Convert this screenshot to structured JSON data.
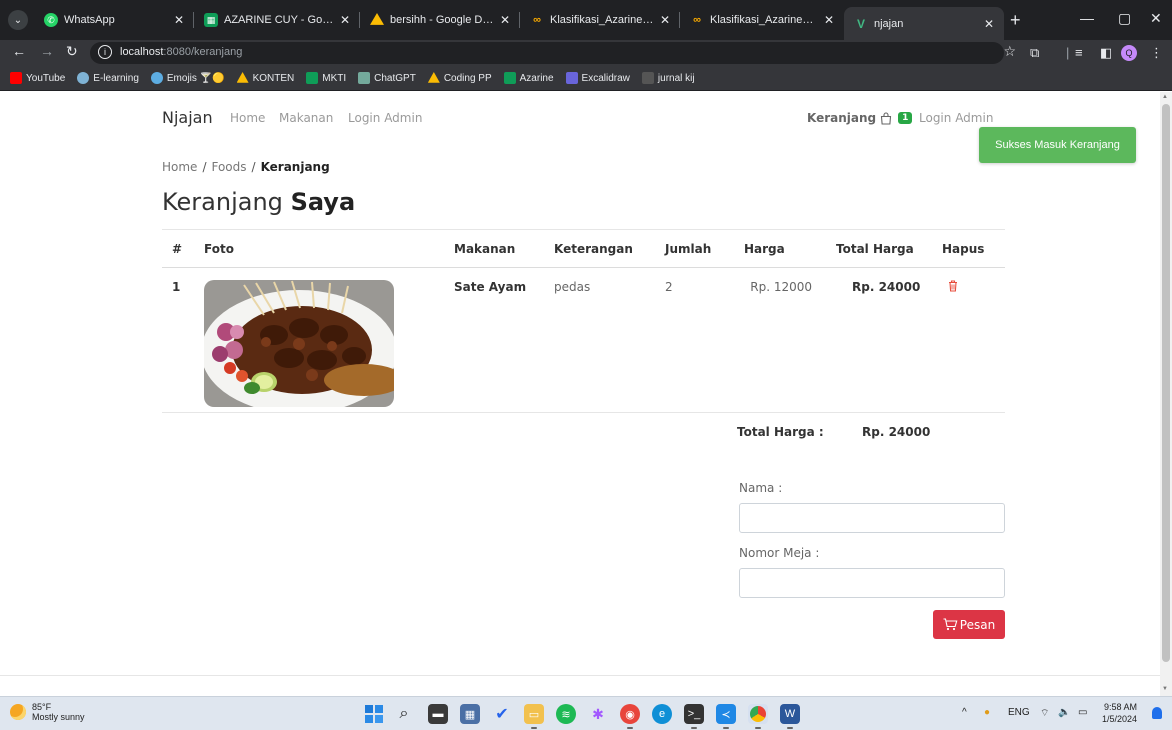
{
  "browser": {
    "tabs": [
      {
        "label": "WhatsApp",
        "icon": "whatsapp-icon",
        "color": "#25d366"
      },
      {
        "label": "AZARINE CUY - Google Sh",
        "icon": "google-sheets-icon",
        "color": "#0f9d58"
      },
      {
        "label": "bersihh - Google Drive",
        "icon": "google-drive-icon",
        "color": "#fbbc04"
      },
      {
        "label": "Klasifikasi_Azarine.ipynb -",
        "icon": "colab-icon",
        "color": "#f9ab00"
      },
      {
        "label": "Klasifikasi_Azarine_PK.ipyn",
        "icon": "colab-icon",
        "color": "#f9ab00"
      },
      {
        "label": "njajan",
        "icon": "vue-icon",
        "color": "#41b883"
      }
    ],
    "url_host": "localhost",
    "url_path": ":8080/keranjang",
    "bookmarks": [
      {
        "label": "YouTube",
        "icon": "youtube-icon",
        "color": "#ff0000"
      },
      {
        "label": "E-learning",
        "icon": "elearning-icon",
        "color": "#7fb3d5"
      },
      {
        "label": "Emojis 🍸🟡",
        "icon": "emoji-icon",
        "color": "#5dade2"
      },
      {
        "label": "KONTEN",
        "icon": "google-drive-icon",
        "color": "#fbbc04"
      },
      {
        "label": "MKTI",
        "icon": "google-sheets-icon",
        "color": "#0f9d58"
      },
      {
        "label": "ChatGPT",
        "icon": "chatgpt-icon",
        "color": "#74aa9c"
      },
      {
        "label": "Coding PP",
        "icon": "google-drive-icon",
        "color": "#fbbc04"
      },
      {
        "label": "Azarine",
        "icon": "google-sheets-icon",
        "color": "#0f9d58"
      },
      {
        "label": "Excalidraw",
        "icon": "excalidraw-icon",
        "color": "#6965db"
      },
      {
        "label": "jurnal kij",
        "icon": "pdf-icon",
        "color": "#555555"
      }
    ],
    "profile_initial": "Q"
  },
  "navbar": {
    "brand": "Njajan",
    "links": [
      "Home",
      "Makanan",
      "Login Admin"
    ],
    "cart_label": "Keranjang",
    "cart_count": "1",
    "right_link": "Login Admin"
  },
  "toast": "Sukses Masuk Keranjang",
  "breadcrumb": {
    "home": "Home",
    "foods": "Foods",
    "current": "Keranjang"
  },
  "heading": {
    "light": "Keranjang",
    "bold": "Saya"
  },
  "table": {
    "headers": [
      "#",
      "Foto",
      "Makanan",
      "Keterangan",
      "Jumlah",
      "Harga",
      "Total Harga",
      "Hapus"
    ],
    "rows": [
      {
        "no": "1",
        "makanan": "Sate Ayam",
        "keterangan": "pedas",
        "jumlah": "2",
        "harga": "Rp. 12000",
        "total": "Rp. 24000"
      }
    ]
  },
  "summary": {
    "label": "Total Harga :",
    "value": "Rp. 24000"
  },
  "form": {
    "nama_label": "Nama :",
    "nama_value": "",
    "meja_label": "Nomor Meja :",
    "meja_value": "",
    "submit": "Pesan"
  },
  "taskbar": {
    "temp": "85°F",
    "weather": "Mostly sunny",
    "lang": "ENG",
    "time": "9:58 AM",
    "date": "1/5/2024"
  },
  "colors": {
    "accent_green": "#28a745",
    "toast_green": "#5cb85c",
    "danger_red": "#dc3545"
  }
}
